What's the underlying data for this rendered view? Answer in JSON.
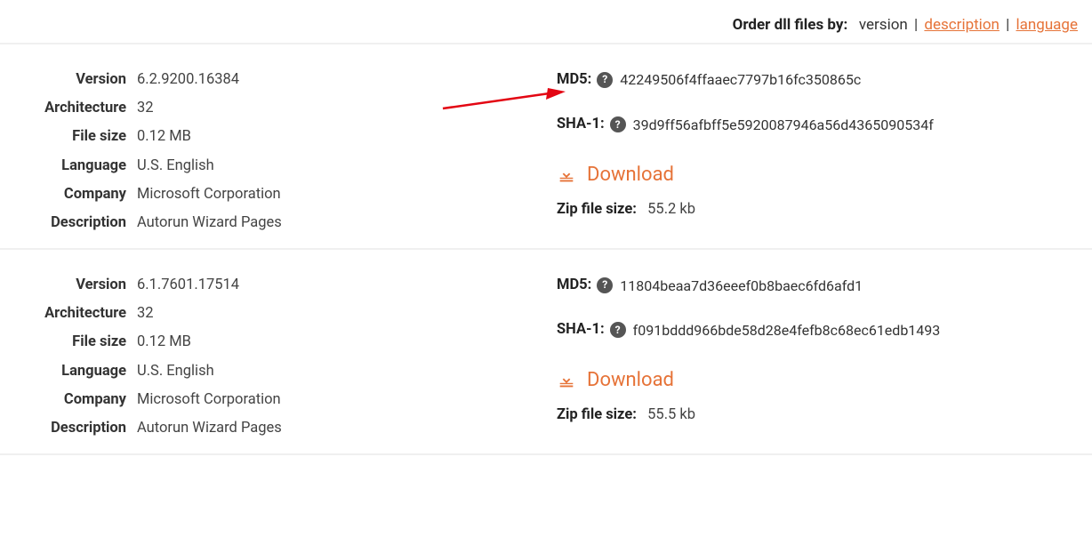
{
  "sort": {
    "label": "Order dll files by:",
    "options": [
      "version",
      "description",
      "language"
    ],
    "active": "version"
  },
  "labels": {
    "version": "Version",
    "architecture": "Architecture",
    "filesize": "File size",
    "language": "Language",
    "company": "Company",
    "description": "Description",
    "md5": "MD5:",
    "sha1": "SHA-1:",
    "download": "Download",
    "zipsize": "Zip file size:"
  },
  "entries": [
    {
      "version": "6.2.9200.16384",
      "architecture": "32",
      "filesize": "0.12 MB",
      "language": "U.S. English",
      "company": "Microsoft Corporation",
      "description": "Autorun Wizard Pages",
      "md5": "42249506f4ffaaec7797b16fc350865c",
      "sha1": "39d9ff56afbff5e5920087946a56d4365090534f",
      "zipsize": "55.2 kb"
    },
    {
      "version": "6.1.7601.17514",
      "architecture": "32",
      "filesize": "0.12 MB",
      "language": "U.S. English",
      "company": "Microsoft Corporation",
      "description": "Autorun Wizard Pages",
      "md5": "11804beaa7d36eeef0b8baec6fd6afd1",
      "sha1": "f091bddd966bde58d28e4fefb8c68ec61edb1493",
      "zipsize": "55.5 kb"
    }
  ]
}
